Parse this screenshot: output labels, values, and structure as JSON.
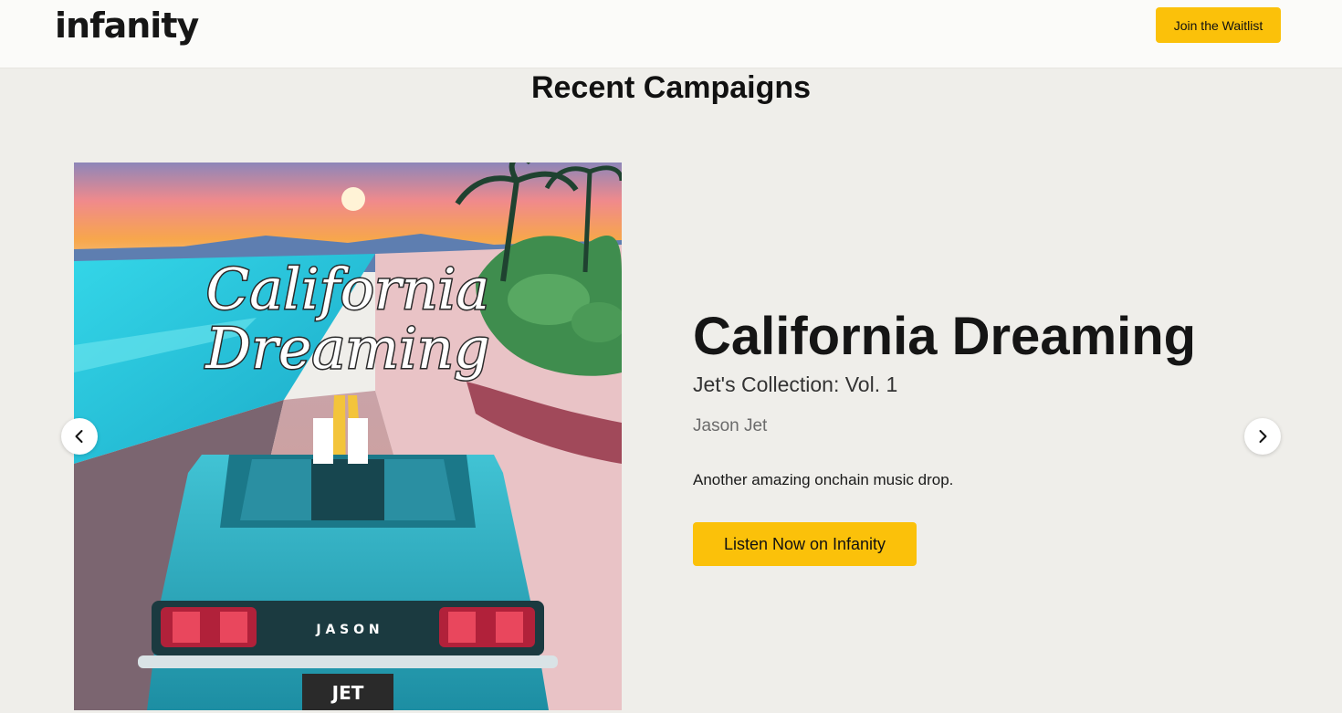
{
  "header": {
    "logo_text": "infanity",
    "waitlist_label": "Join the Waitlist"
  },
  "section": {
    "title": "Recent Campaigns"
  },
  "campaign": {
    "title": "California Dreaming",
    "subtitle": "Jet's Collection: Vol. 1",
    "artist": "Jason Jet",
    "description": "Another amazing onchain music drop.",
    "cta_label": "Listen Now on Infanity",
    "cover_art": {
      "script_line1": "California",
      "script_line2": "Dreaming",
      "plate_text": "J A S O N",
      "license_text": "JET"
    }
  },
  "carousel": {
    "prev_icon": "chevron-left-icon",
    "next_icon": "chevron-right-icon"
  },
  "colors": {
    "accent": "#fbc10a",
    "background": "#efeeea",
    "header_bg": "#fbfbf9",
    "text": "#111111"
  }
}
